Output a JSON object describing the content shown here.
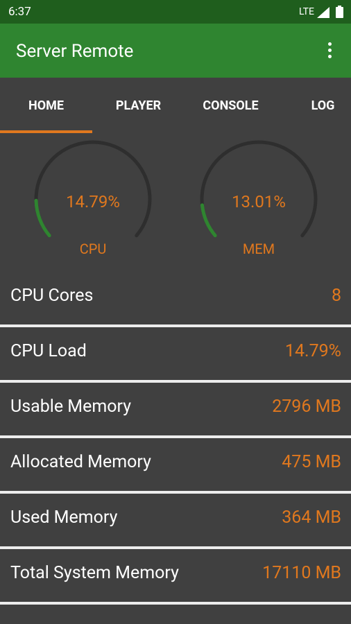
{
  "status_bar": {
    "time": "6:37",
    "network": "LTE"
  },
  "app_bar": {
    "title": "Server Remote",
    "menu_icon": "more-vert-icon"
  },
  "tabs": [
    {
      "label": "HOME",
      "active": true
    },
    {
      "label": "PLAYER",
      "active": false
    },
    {
      "label": "CONSOLE",
      "active": false
    },
    {
      "label": "LOG",
      "active": false
    }
  ],
  "gauges": [
    {
      "value_text": "14.79%",
      "label": "CPU",
      "fraction": 0.1479
    },
    {
      "value_text": "13.01%",
      "label": "MEM",
      "fraction": 0.1301
    }
  ],
  "stats": [
    {
      "name": "CPU Cores",
      "value": "8"
    },
    {
      "name": "CPU Load",
      "value": "14.79%"
    },
    {
      "name": "Usable Memory",
      "value": "2796 MB"
    },
    {
      "name": "Allocated Memory",
      "value": "475 MB"
    },
    {
      "name": "Used Memory",
      "value": "364 MB"
    },
    {
      "name": "Total System Memory",
      "value": "17110 MB"
    }
  ],
  "colors": {
    "status_bar": "#1f5e1d",
    "app_bar": "#2f8530",
    "background": "#404040",
    "accent": "#e0781e",
    "gauge_track": "#2e2e2e",
    "gauge_fill": "#2f8530",
    "divider": "#ededed"
  }
}
